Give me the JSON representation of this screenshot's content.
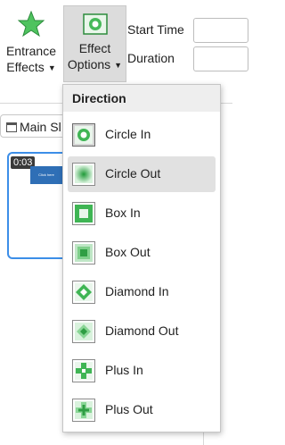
{
  "ribbon": {
    "entrance_effects": {
      "line1": "Entrance",
      "line2": "Effects",
      "icon": "star-icon"
    },
    "effect_options": {
      "line1": "Effect",
      "line2": "Options",
      "icon": "circle-in-icon"
    }
  },
  "timing": {
    "start_time_label": "Start Time",
    "duration_label": "Duration"
  },
  "tab": {
    "label": "Main Sl"
  },
  "thumbnail": {
    "time": "0:03",
    "mini_text": "Click here"
  },
  "dropdown": {
    "header": "Direction",
    "items": [
      {
        "label": "Circle In",
        "icon": "circle-in-icon"
      },
      {
        "label": "Circle Out",
        "icon": "circle-out-icon"
      },
      {
        "label": "Box In",
        "icon": "box-in-icon"
      },
      {
        "label": "Box Out",
        "icon": "box-out-icon"
      },
      {
        "label": "Diamond In",
        "icon": "diamond-in-icon"
      },
      {
        "label": "Diamond Out",
        "icon": "diamond-out-icon"
      },
      {
        "label": "Plus In",
        "icon": "plus-in-icon"
      },
      {
        "label": "Plus Out",
        "icon": "plus-out-icon"
      }
    ]
  },
  "colors": {
    "accent_green": "#2fae4a",
    "selection_blue": "#3c8ee8"
  }
}
